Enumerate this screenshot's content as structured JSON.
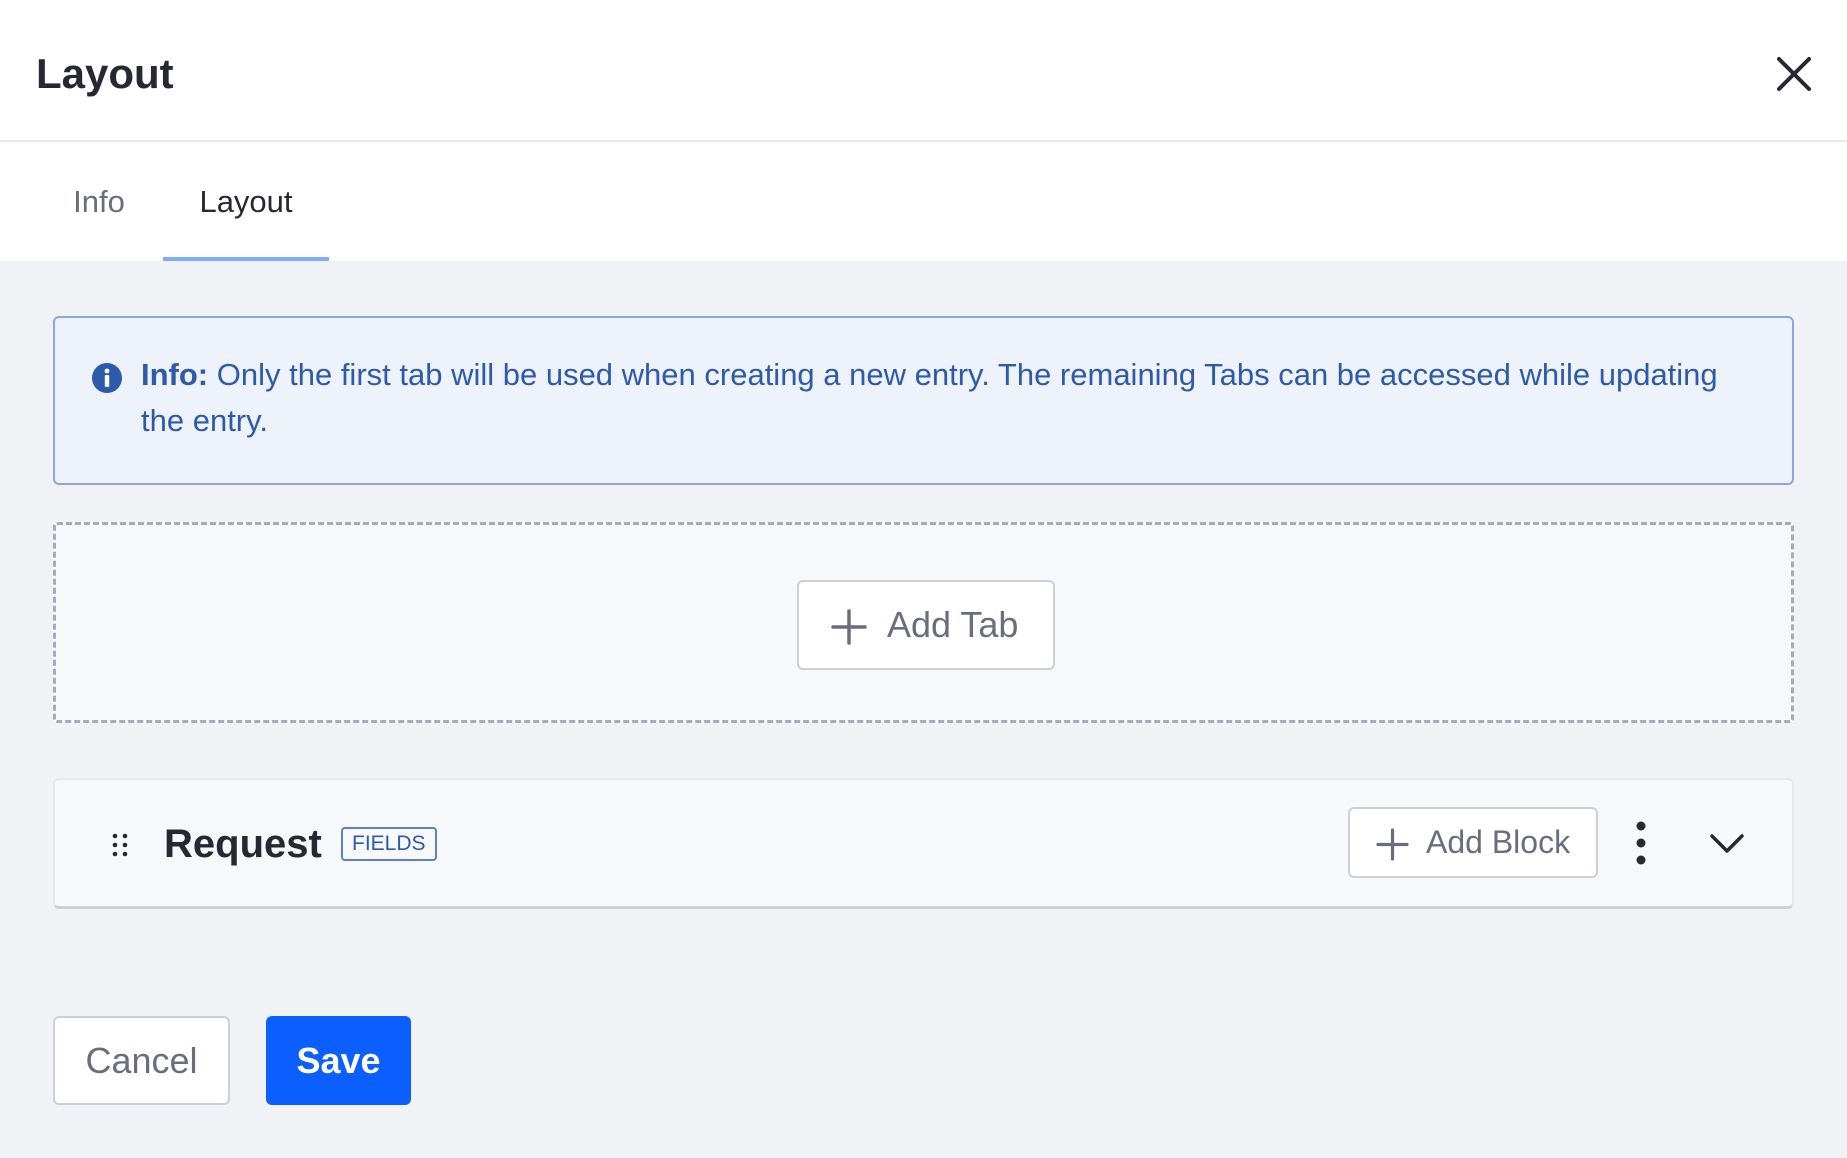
{
  "header": {
    "title": "Layout",
    "close_icon": "close-icon"
  },
  "tabs": [
    {
      "label": "Info",
      "active": false
    },
    {
      "label": "Layout",
      "active": true
    }
  ],
  "alert": {
    "icon": "info-circle-icon",
    "lead": "Info:",
    "message": " Only the first tab will be used when creating a new entry. The remaining Tabs can be accessed while updating the entry.",
    "color": "#2e5aac"
  },
  "dropzone": {
    "add_tab_label": "Add Tab",
    "add_tab_icon": "plus-icon"
  },
  "request_panel": {
    "title": "Request",
    "badge": "FIELDS",
    "add_block_label": "Add Block",
    "drag_icon": "drag-handle-icon",
    "kebab_icon": "ellipsis-v-icon",
    "chevron_icon": "chevron-down-icon"
  },
  "footer": {
    "cancel_label": "Cancel",
    "save_label": "Save",
    "primary_color": "#0b5fff"
  }
}
